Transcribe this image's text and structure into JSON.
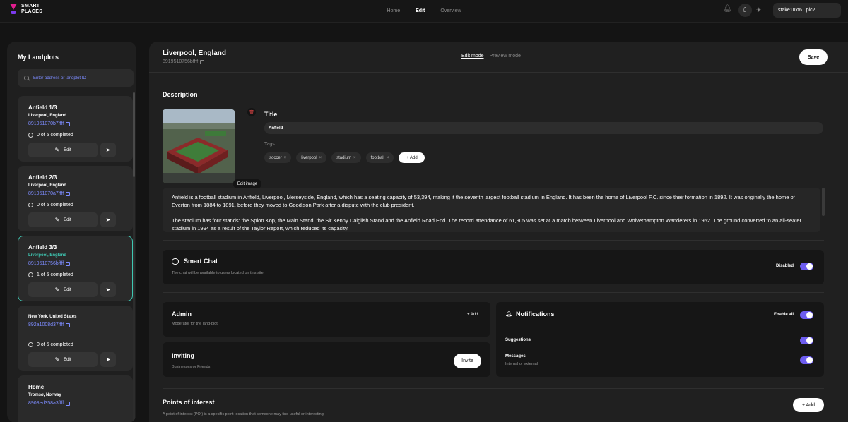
{
  "brand": {
    "line1": "SMART",
    "line2": "PLACES"
  },
  "nav": {
    "home": "Home",
    "edit": "Edit",
    "overview": "Overview"
  },
  "account": {
    "label": "stake1uxt6...pic2"
  },
  "sidebar": {
    "title": "My Landplots",
    "search_placeholder": "Enter address or landplot ID",
    "items": [
      {
        "name": "Anfield 1/3",
        "location": "Liverpool, England",
        "id": "891951070b7ffff",
        "progress": "0 of 5 completed",
        "edit_label": "Edit"
      },
      {
        "name": "Anfield 2/3",
        "location": "Liverpool, England",
        "id": "891951070a7ffff",
        "progress": "0 of 5 completed",
        "edit_label": "Edit"
      },
      {
        "name": "Anfield 3/3",
        "location": "Liverpool, England",
        "id": "8919510756bffff",
        "progress": "1 of 5 completed",
        "edit_label": "Edit"
      },
      {
        "name": "",
        "location": "New York, United States",
        "id": "892a1008d37ffff",
        "progress": "0 of 5 completed",
        "edit_label": "Edit"
      },
      {
        "name": "Home",
        "location": "Tromsø, Norway",
        "id": "8908ed358a3ffff",
        "progress": "",
        "edit_label": ""
      }
    ]
  },
  "header": {
    "title": "Liverpool, England",
    "id": "8919510756bffff",
    "edit_mode": "Edit mode",
    "preview_mode": "Preview mode",
    "save": "Save"
  },
  "description": {
    "section_title": "Description",
    "edit_image": "Edit image",
    "title_label": "Title",
    "title_value": "Anfield",
    "tags_label": "Tags:",
    "tags": [
      "soccer",
      "liverpool",
      "stadium",
      "football"
    ],
    "add_tag": "+ Add",
    "paragraph1": "Anfield is a football stadium in Anfield, Liverpool, Merseyside, England, which has a seating capacity of 53,394, making it the seventh largest football stadium in England. It has been the home of Liverpool F.C. since their formation in 1892. It was originally the home of Everton from 1884 to 1891, before they moved to Goodison Park after a dispute with the club president.",
    "paragraph2": "The stadium has four stands: the Spion Kop, the Main Stand, the Sir Kenny Dalglish Stand and the Anfield Road End. The record attendance of 61,905 was set at a match between Liverpool and Wolverhampton Wanderers in 1952. The ground converted to an all-seater stadium in 1994 as a result of the Taylor Report, which reduced its capacity."
  },
  "smart_chat": {
    "title": "Smart Chat",
    "subtitle": "The chat will be available to users located on this site",
    "toggle_label": "Disabled"
  },
  "admin": {
    "title": "Admin",
    "subtitle": "Moderator for the land-plot",
    "add": "+ Add"
  },
  "inviting": {
    "title": "Inviting",
    "subtitle": "Businesses or Friends",
    "button": "Invite"
  },
  "notifications": {
    "title": "Notifications",
    "enable_all": "Enable all",
    "suggestions": "Suggestions",
    "messages": "Messages",
    "messages_sub": "Internal or external"
  },
  "poi": {
    "title": "Points of interest",
    "description": "A point of interest (POI) is a specific point location that someone may find useful or interesting",
    "add": "+ Add"
  },
  "colors": {
    "accent": "#6d5df0",
    "link": "#7d8cff",
    "selected": "#3fc7b2"
  }
}
